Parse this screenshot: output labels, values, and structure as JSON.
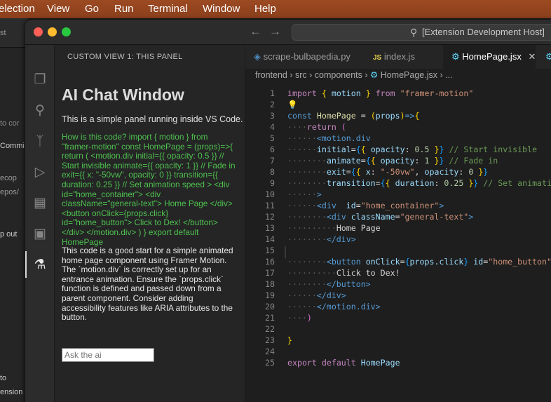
{
  "menubar": {
    "items": [
      "election",
      "View",
      "Go",
      "Run",
      "Terminal",
      "Window",
      "Help"
    ]
  },
  "bgwin": {
    "texts": [
      "st",
      "to cor",
      "Commi",
      "ecop",
      "epos/",
      "p  out",
      "to",
      "ension"
    ]
  },
  "window": {
    "search": "[Extension Development Host]",
    "panel": {
      "header": "CUSTOM VIEW 1: THIS PANEL",
      "title": "AI Chat Window",
      "intro": "This is a simple panel running inside VS Code.",
      "question": "How is this code? import { motion } from \"framer-motion\" const HomePage = (props)=>{ return ( <motion.div initial={{ opacity: 0.5 }} // Start invisible animate={{ opacity: 1 }} // Fade in exit={{ x: \"-50vw\", opacity: 0 }} transition={{ duration: 0.25 }} // Set animation speed > <div id=\"home_container\"> <div className=\"general-text\"> Home Page </div> <button onClick={props.click} id=\"home_button\"> Click to Dex! </button> </div> </motion.div> ) } export default HomePage",
      "answer": "This code is a good start for a simple animated home page component using Framer Motion. The `motion.div` is correctly set up for an entrance animation. Ensure the `props.click` function is defined and passed down from a parent component. Consider adding accessibility features like ARIA attributes to the button.",
      "input_placeholder": "Ask the ai"
    },
    "tabs": [
      {
        "label": "scrape-bulbapedia.py",
        "icon": "python-icon"
      },
      {
        "label": "index.js",
        "icon": "js-icon"
      },
      {
        "label": "HomePage.jsx",
        "icon": "react-icon",
        "active": true
      }
    ],
    "breadcrumb": [
      "frontend",
      "src",
      "components",
      "HomePage.jsx",
      "..."
    ],
    "code_line_numbers": [
      "1",
      "2",
      "3",
      "4",
      "5",
      "6",
      "7",
      "8",
      "9",
      "10",
      "11",
      "12",
      "13",
      "14",
      "15",
      "16",
      "17",
      "18",
      "19",
      "20",
      "21",
      "22",
      "23",
      "24",
      "25"
    ]
  }
}
